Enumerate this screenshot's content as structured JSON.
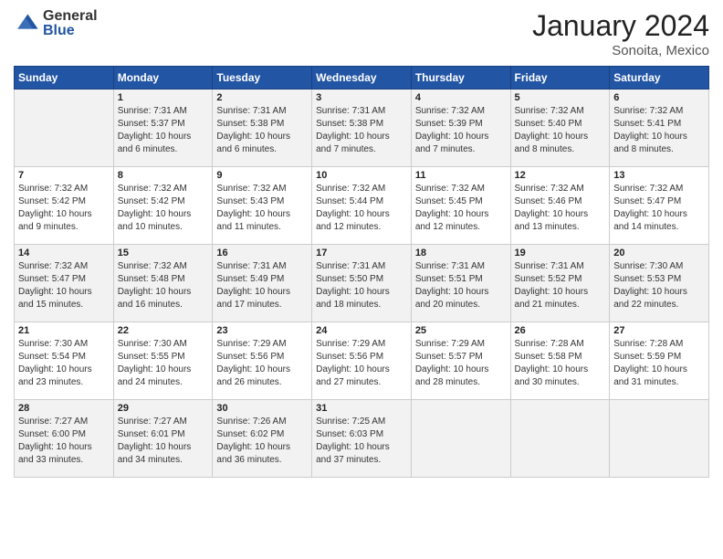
{
  "header": {
    "logo_general": "General",
    "logo_blue": "Blue",
    "month_title": "January 2024",
    "location": "Sonoita, Mexico"
  },
  "days_of_week": [
    "Sunday",
    "Monday",
    "Tuesday",
    "Wednesday",
    "Thursday",
    "Friday",
    "Saturday"
  ],
  "weeks": [
    [
      {
        "day": "",
        "info": ""
      },
      {
        "day": "1",
        "info": "Sunrise: 7:31 AM\nSunset: 5:37 PM\nDaylight: 10 hours\nand 6 minutes."
      },
      {
        "day": "2",
        "info": "Sunrise: 7:31 AM\nSunset: 5:38 PM\nDaylight: 10 hours\nand 6 minutes."
      },
      {
        "day": "3",
        "info": "Sunrise: 7:31 AM\nSunset: 5:38 PM\nDaylight: 10 hours\nand 7 minutes."
      },
      {
        "day": "4",
        "info": "Sunrise: 7:32 AM\nSunset: 5:39 PM\nDaylight: 10 hours\nand 7 minutes."
      },
      {
        "day": "5",
        "info": "Sunrise: 7:32 AM\nSunset: 5:40 PM\nDaylight: 10 hours\nand 8 minutes."
      },
      {
        "day": "6",
        "info": "Sunrise: 7:32 AM\nSunset: 5:41 PM\nDaylight: 10 hours\nand 8 minutes."
      }
    ],
    [
      {
        "day": "7",
        "info": "Sunrise: 7:32 AM\nSunset: 5:42 PM\nDaylight: 10 hours\nand 9 minutes."
      },
      {
        "day": "8",
        "info": "Sunrise: 7:32 AM\nSunset: 5:42 PM\nDaylight: 10 hours\nand 10 minutes."
      },
      {
        "day": "9",
        "info": "Sunrise: 7:32 AM\nSunset: 5:43 PM\nDaylight: 10 hours\nand 11 minutes."
      },
      {
        "day": "10",
        "info": "Sunrise: 7:32 AM\nSunset: 5:44 PM\nDaylight: 10 hours\nand 12 minutes."
      },
      {
        "day": "11",
        "info": "Sunrise: 7:32 AM\nSunset: 5:45 PM\nDaylight: 10 hours\nand 12 minutes."
      },
      {
        "day": "12",
        "info": "Sunrise: 7:32 AM\nSunset: 5:46 PM\nDaylight: 10 hours\nand 13 minutes."
      },
      {
        "day": "13",
        "info": "Sunrise: 7:32 AM\nSunset: 5:47 PM\nDaylight: 10 hours\nand 14 minutes."
      }
    ],
    [
      {
        "day": "14",
        "info": "Sunrise: 7:32 AM\nSunset: 5:47 PM\nDaylight: 10 hours\nand 15 minutes."
      },
      {
        "day": "15",
        "info": "Sunrise: 7:32 AM\nSunset: 5:48 PM\nDaylight: 10 hours\nand 16 minutes."
      },
      {
        "day": "16",
        "info": "Sunrise: 7:31 AM\nSunset: 5:49 PM\nDaylight: 10 hours\nand 17 minutes."
      },
      {
        "day": "17",
        "info": "Sunrise: 7:31 AM\nSunset: 5:50 PM\nDaylight: 10 hours\nand 18 minutes."
      },
      {
        "day": "18",
        "info": "Sunrise: 7:31 AM\nSunset: 5:51 PM\nDaylight: 10 hours\nand 20 minutes."
      },
      {
        "day": "19",
        "info": "Sunrise: 7:31 AM\nSunset: 5:52 PM\nDaylight: 10 hours\nand 21 minutes."
      },
      {
        "day": "20",
        "info": "Sunrise: 7:30 AM\nSunset: 5:53 PM\nDaylight: 10 hours\nand 22 minutes."
      }
    ],
    [
      {
        "day": "21",
        "info": "Sunrise: 7:30 AM\nSunset: 5:54 PM\nDaylight: 10 hours\nand 23 minutes."
      },
      {
        "day": "22",
        "info": "Sunrise: 7:30 AM\nSunset: 5:55 PM\nDaylight: 10 hours\nand 24 minutes."
      },
      {
        "day": "23",
        "info": "Sunrise: 7:29 AM\nSunset: 5:56 PM\nDaylight: 10 hours\nand 26 minutes."
      },
      {
        "day": "24",
        "info": "Sunrise: 7:29 AM\nSunset: 5:56 PM\nDaylight: 10 hours\nand 27 minutes."
      },
      {
        "day": "25",
        "info": "Sunrise: 7:29 AM\nSunset: 5:57 PM\nDaylight: 10 hours\nand 28 minutes."
      },
      {
        "day": "26",
        "info": "Sunrise: 7:28 AM\nSunset: 5:58 PM\nDaylight: 10 hours\nand 30 minutes."
      },
      {
        "day": "27",
        "info": "Sunrise: 7:28 AM\nSunset: 5:59 PM\nDaylight: 10 hours\nand 31 minutes."
      }
    ],
    [
      {
        "day": "28",
        "info": "Sunrise: 7:27 AM\nSunset: 6:00 PM\nDaylight: 10 hours\nand 33 minutes."
      },
      {
        "day": "29",
        "info": "Sunrise: 7:27 AM\nSunset: 6:01 PM\nDaylight: 10 hours\nand 34 minutes."
      },
      {
        "day": "30",
        "info": "Sunrise: 7:26 AM\nSunset: 6:02 PM\nDaylight: 10 hours\nand 36 minutes."
      },
      {
        "day": "31",
        "info": "Sunrise: 7:25 AM\nSunset: 6:03 PM\nDaylight: 10 hours\nand 37 minutes."
      },
      {
        "day": "",
        "info": ""
      },
      {
        "day": "",
        "info": ""
      },
      {
        "day": "",
        "info": ""
      }
    ]
  ]
}
